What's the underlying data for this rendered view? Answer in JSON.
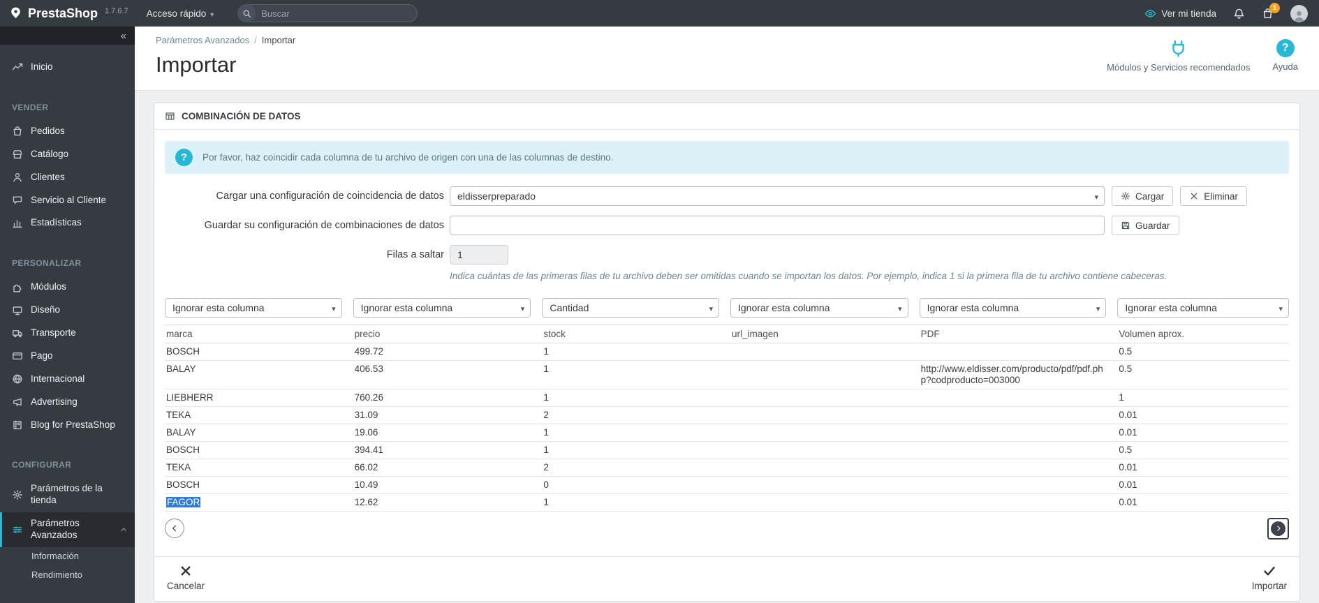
{
  "topbar": {
    "brand": "PrestaShop",
    "version": "1.7.6.7",
    "quick_access": "Acceso rápido",
    "search_placeholder": "Buscar",
    "view_shop": "Ver mi tienda",
    "notifications_badge": "1",
    "icons": {
      "logo": "prestashop-logo-icon",
      "search": "search-icon",
      "view_shop": "eye-icon",
      "notifications": "bell-icon",
      "orders": "cart-icon",
      "avatar": "avatar-icon"
    }
  },
  "sidebar": {
    "collapse_icon": "«",
    "entries": [
      {
        "type": "item",
        "label": "Inicio",
        "icon": "trending-icon"
      },
      {
        "type": "header",
        "label": "VENDER"
      },
      {
        "type": "item",
        "label": "Pedidos",
        "icon": "bag-icon"
      },
      {
        "type": "item",
        "label": "Catálogo",
        "icon": "store-icon"
      },
      {
        "type": "item",
        "label": "Clientes",
        "icon": "person-icon"
      },
      {
        "type": "item",
        "label": "Servicio al Cliente",
        "icon": "chat-icon"
      },
      {
        "type": "item",
        "label": "Estadísticas",
        "icon": "stats-icon"
      },
      {
        "type": "header",
        "label": "PERSONALIZAR"
      },
      {
        "type": "item",
        "label": "Módulos",
        "icon": "puzzle-icon"
      },
      {
        "type": "item",
        "label": "Diseño",
        "icon": "monitor-icon"
      },
      {
        "type": "item",
        "label": "Transporte",
        "icon": "truck-icon"
      },
      {
        "type": "item",
        "label": "Pago",
        "icon": "card-icon"
      },
      {
        "type": "item",
        "label": "Internacional",
        "icon": "globe-icon"
      },
      {
        "type": "item",
        "label": "Advertising",
        "icon": "megaphone-icon"
      },
      {
        "type": "item",
        "label": "Blog for PrestaShop",
        "icon": "book-icon"
      },
      {
        "type": "header",
        "label": "CONFIGURAR"
      },
      {
        "type": "item",
        "label": "Parámetros de la tienda",
        "icon": "gear-icon"
      },
      {
        "type": "item",
        "label": "Parámetros Avanzados",
        "icon": "settings-icon",
        "active": true,
        "chevron": "up"
      },
      {
        "type": "subitem",
        "label": "Información"
      },
      {
        "type": "subitem",
        "label": "Rendimiento"
      }
    ]
  },
  "header": {
    "breadcrumb": [
      "Parámetros Avanzados",
      "Importar"
    ],
    "title": "Importar",
    "links": [
      {
        "label": "Módulos y Servicios recomendados",
        "icon": "plugin-icon"
      },
      {
        "label": "Ayuda",
        "icon": "help-icon"
      }
    ]
  },
  "panel": {
    "title": "COMBINACIÓN DE DATOS",
    "title_icon": "table-icon",
    "alert": {
      "icon": "question-circle-icon",
      "text": "Por favor, haz coincidir cada columna de tu archivo de origen con una de las columnas de destino."
    },
    "form": {
      "load_label": "Cargar una configuración de coincidencia de datos",
      "load_value": "eldisserpreparado",
      "load_button": "Cargar",
      "load_icon": "cogs-icon",
      "delete_button": "Eliminar",
      "delete_icon": "x-icon",
      "save_label": "Guardar su configuración de combinaciones de datos",
      "save_value": "",
      "save_button": "Guardar",
      "save_icon": "save-icon",
      "skip_label": "Filas a saltar",
      "skip_value": "1",
      "skip_help": "Indica cuántas de las primeras filas de tu archivo deben ser omitidas cuando se importan los datos. Por ejemplo, indica 1 si la primera fila de tu archivo contiene cabeceras."
    },
    "column_selects": [
      "Ignorar esta columna",
      "Ignorar esta columna",
      "Cantidad",
      "Ignorar esta columna",
      "Ignorar esta columna",
      "Ignorar esta columna"
    ],
    "table": {
      "headers": [
        "marca",
        "precio",
        "stock",
        "url_imagen",
        "PDF",
        "Volumen aprox."
      ],
      "rows": [
        [
          "BOSCH",
          "499.72",
          "1",
          "",
          "",
          "0.5"
        ],
        [
          "BALAY",
          "406.53",
          "1",
          "",
          "http://www.eldisser.com/producto/pdf/pdf.php?codproducto=003000",
          "0.5"
        ],
        [
          "LIEBHERR",
          "760.26",
          "1",
          "",
          "",
          "1"
        ],
        [
          "TEKA",
          "31.09",
          "2",
          "",
          "",
          "0.01"
        ],
        [
          "BALAY",
          "19.06",
          "1",
          "",
          "",
          "0.01"
        ],
        [
          "BOSCH",
          "394.41",
          "1",
          "",
          "",
          "0.5"
        ],
        [
          "TEKA",
          "66.02",
          "2",
          "",
          "",
          "0.01"
        ],
        [
          "BOSCH",
          "10.49",
          "0",
          "",
          "",
          "0.01"
        ],
        [
          "FAGOR",
          "12.62",
          "1",
          "",
          "",
          "0.01"
        ]
      ],
      "selected": {
        "row": 8,
        "col": 0
      }
    },
    "table_nav": {
      "left_icon": "chevron-left-icon",
      "right_icon": "arrow-right-icon"
    },
    "footer": {
      "cancel": "Cancelar",
      "cancel_icon": "x-icon",
      "import": "Importar",
      "import_icon": "check-icon"
    }
  },
  "colors": {
    "accent": "#25b9d7",
    "topbar_bg": "#363a41",
    "selection": "#2f7cd8",
    "badge": "#f9a11b"
  }
}
